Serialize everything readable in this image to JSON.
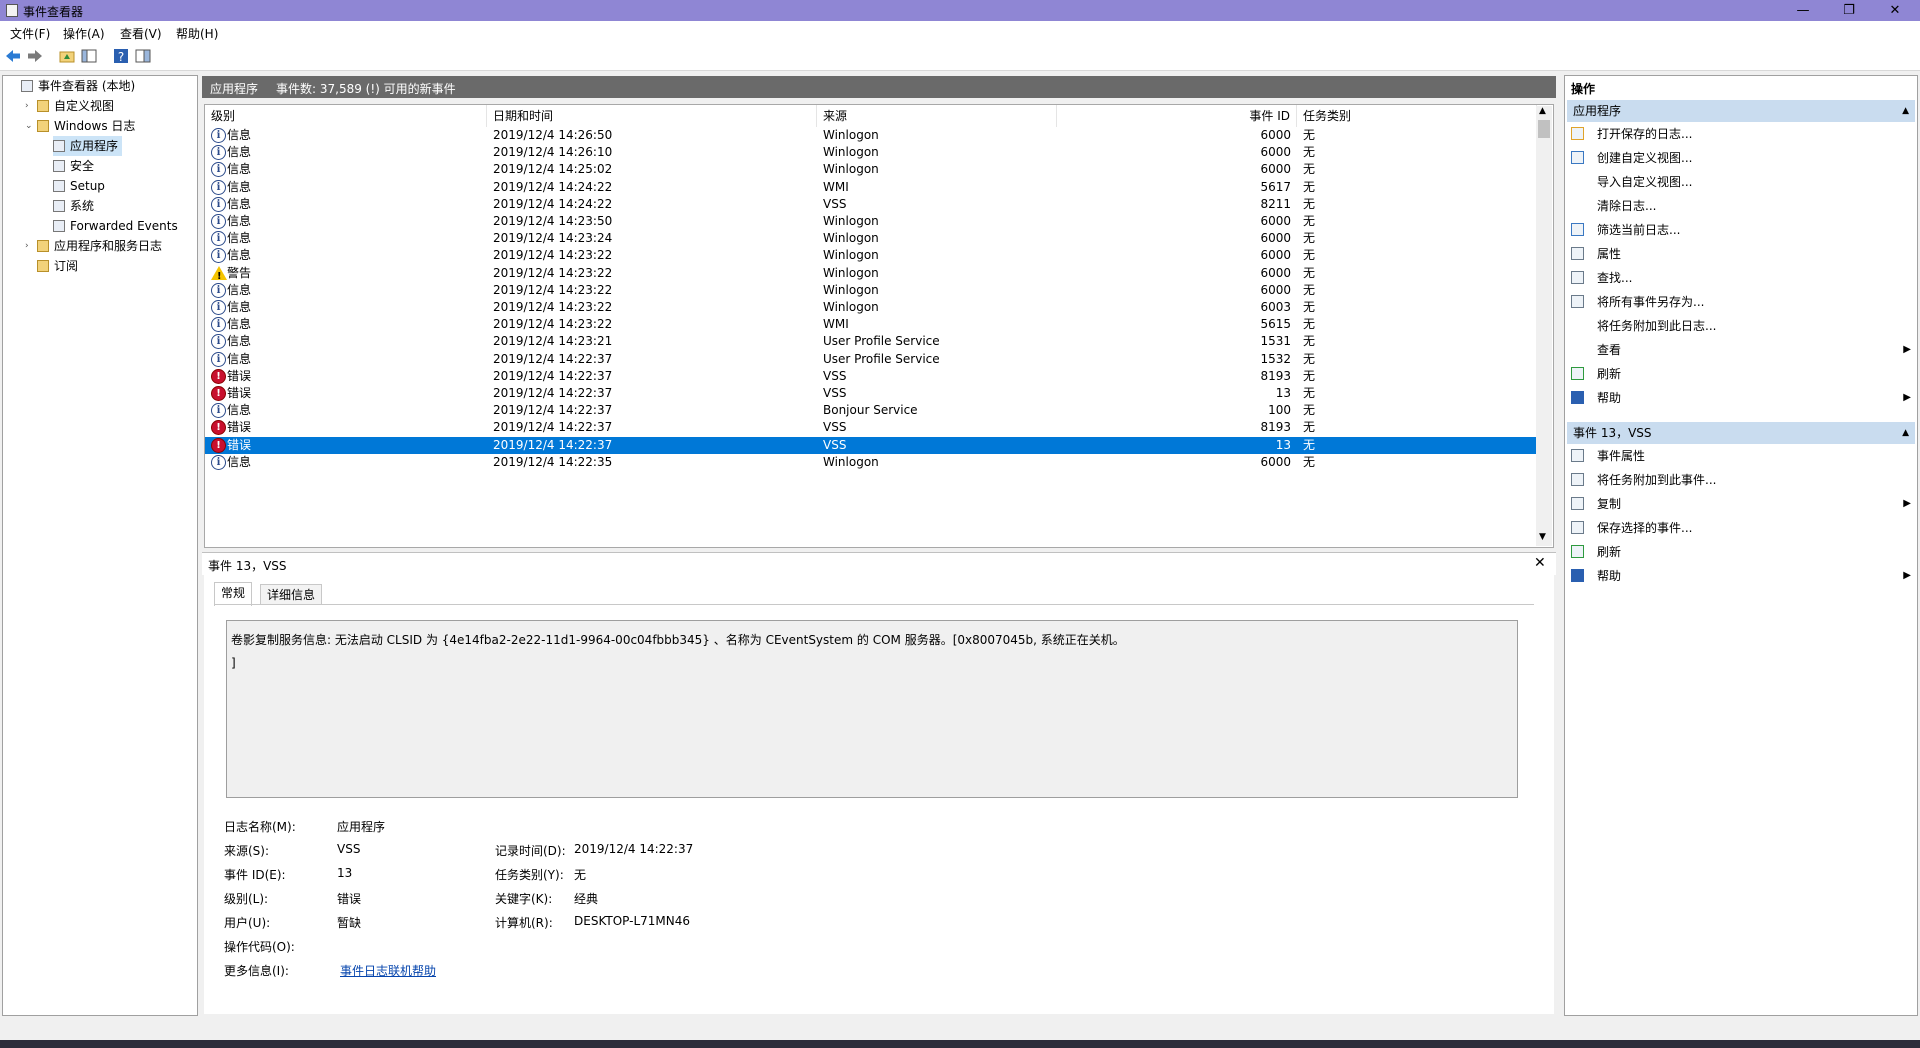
{
  "window": {
    "title": "事件查看器",
    "min": "—",
    "max": "❐",
    "close": "✕"
  },
  "menu": [
    "文件(F)",
    "操作(A)",
    "查看(V)",
    "帮助(H)"
  ],
  "tree": [
    {
      "label": "事件查看器 (本地)",
      "indent": 0,
      "exp": ""
    },
    {
      "label": "自定义视图",
      "indent": 1,
      "exp": "›",
      "folder": true
    },
    {
      "label": "Windows 日志",
      "indent": 1,
      "exp": "⌄",
      "folder": true
    },
    {
      "label": "应用程序",
      "indent": 2,
      "exp": "",
      "selected": true
    },
    {
      "label": "安全",
      "indent": 2,
      "exp": ""
    },
    {
      "label": "Setup",
      "indent": 2,
      "exp": ""
    },
    {
      "label": "系统",
      "indent": 2,
      "exp": ""
    },
    {
      "label": "Forwarded Events",
      "indent": 2,
      "exp": ""
    },
    {
      "label": "应用程序和服务日志",
      "indent": 1,
      "exp": "›",
      "folder": true
    },
    {
      "label": "订阅",
      "indent": 1,
      "exp": "",
      "folder": true
    }
  ],
  "center": {
    "log_name": "应用程序",
    "summary": "事件数: 37,589 (!) 可用的新事件"
  },
  "columns": [
    "级别",
    "日期和时间",
    "来源",
    "事件 ID",
    "任务类别"
  ],
  "events": [
    {
      "level": "info",
      "level_text": "信息",
      "datetime": "2019/12/4 14:26:50",
      "source": "Winlogon",
      "id": "6000",
      "task": "无"
    },
    {
      "level": "info",
      "level_text": "信息",
      "datetime": "2019/12/4 14:26:10",
      "source": "Winlogon",
      "id": "6000",
      "task": "无"
    },
    {
      "level": "info",
      "level_text": "信息",
      "datetime": "2019/12/4 14:25:02",
      "source": "Winlogon",
      "id": "6000",
      "task": "无"
    },
    {
      "level": "info",
      "level_text": "信息",
      "datetime": "2019/12/4 14:24:22",
      "source": "WMI",
      "id": "5617",
      "task": "无"
    },
    {
      "level": "info",
      "level_text": "信息",
      "datetime": "2019/12/4 14:24:22",
      "source": "VSS",
      "id": "8211",
      "task": "无"
    },
    {
      "level": "info",
      "level_text": "信息",
      "datetime": "2019/12/4 14:23:50",
      "source": "Winlogon",
      "id": "6000",
      "task": "无"
    },
    {
      "level": "info",
      "level_text": "信息",
      "datetime": "2019/12/4 14:23:24",
      "source": "Winlogon",
      "id": "6000",
      "task": "无"
    },
    {
      "level": "info",
      "level_text": "信息",
      "datetime": "2019/12/4 14:23:22",
      "source": "Winlogon",
      "id": "6000",
      "task": "无"
    },
    {
      "level": "warn",
      "level_text": "警告",
      "datetime": "2019/12/4 14:23:22",
      "source": "Winlogon",
      "id": "6000",
      "task": "无"
    },
    {
      "level": "info",
      "level_text": "信息",
      "datetime": "2019/12/4 14:23:22",
      "source": "Winlogon",
      "id": "6000",
      "task": "无"
    },
    {
      "level": "info",
      "level_text": "信息",
      "datetime": "2019/12/4 14:23:22",
      "source": "Winlogon",
      "id": "6003",
      "task": "无"
    },
    {
      "level": "info",
      "level_text": "信息",
      "datetime": "2019/12/4 14:23:22",
      "source": "WMI",
      "id": "5615",
      "task": "无"
    },
    {
      "level": "info",
      "level_text": "信息",
      "datetime": "2019/12/4 14:23:21",
      "source": "User Profile Service",
      "id": "1531",
      "task": "无"
    },
    {
      "level": "info",
      "level_text": "信息",
      "datetime": "2019/12/4 14:22:37",
      "source": "User Profile Service",
      "id": "1532",
      "task": "无"
    },
    {
      "level": "err",
      "level_text": "错误",
      "datetime": "2019/12/4 14:22:37",
      "source": "VSS",
      "id": "8193",
      "task": "无"
    },
    {
      "level": "err",
      "level_text": "错误",
      "datetime": "2019/12/4 14:22:37",
      "source": "VSS",
      "id": "13",
      "task": "无"
    },
    {
      "level": "info",
      "level_text": "信息",
      "datetime": "2019/12/4 14:22:37",
      "source": "Bonjour Service",
      "id": "100",
      "task": "无"
    },
    {
      "level": "err",
      "level_text": "错误",
      "datetime": "2019/12/4 14:22:37",
      "source": "VSS",
      "id": "8193",
      "task": "无"
    },
    {
      "level": "err",
      "level_text": "错误",
      "datetime": "2019/12/4 14:22:37",
      "source": "VSS",
      "id": "13",
      "task": "无",
      "selected": true
    },
    {
      "level": "info",
      "level_text": "信息",
      "datetime": "2019/12/4 14:22:35",
      "source": "Winlogon",
      "id": "6000",
      "task": "无"
    }
  ],
  "detail": {
    "title": "事件 13，VSS",
    "tabs": [
      "常规",
      "详细信息"
    ],
    "description_line1": "卷影复制服务信息: 无法启动 CLSID 为 {4e14fba2-2e22-11d1-9964-00c04fbbb345} 、名称为 CEventSystem 的 COM 服务器。[0x8007045b, 系统正在关机。",
    "description_line2": "]",
    "fields": {
      "log_name_label": "日志名称(M):",
      "log_name": "应用程序",
      "source_label": "来源(S):",
      "source": "VSS",
      "logged_label": "记录时间(D):",
      "logged": "2019/12/4 14:22:37",
      "event_id_label": "事件 ID(E):",
      "event_id": "13",
      "task_label": "任务类别(Y):",
      "task": "无",
      "level_label": "级别(L):",
      "level": "错误",
      "keywords_label": "关键字(K):",
      "keywords": "经典",
      "user_label": "用户(U):",
      "user": "暂缺",
      "computer_label": "计算机(R):",
      "computer": "DESKTOP-L71MN46",
      "opcode_label": "操作代码(O):",
      "more_info_label": "更多信息(I):",
      "more_info_link": "事件日志联机帮助"
    }
  },
  "actions": {
    "title": "操作",
    "section1": "应用程序",
    "items1": [
      {
        "label": "打开保存的日志...",
        "icon": "open-log-icon"
      },
      {
        "label": "创建自定义视图...",
        "icon": "create-view-icon"
      },
      {
        "label": "导入自定义视图...",
        "icon": ""
      },
      {
        "label": "清除日志...",
        "icon": ""
      },
      {
        "label": "筛选当前日志...",
        "icon": "filter-icon"
      },
      {
        "label": "属性",
        "icon": "properties-icon"
      },
      {
        "label": "查找...",
        "icon": "find-icon"
      },
      {
        "label": "将所有事件另存为...",
        "icon": "save-icon"
      },
      {
        "label": "将任务附加到此日志...",
        "icon": ""
      },
      {
        "label": "查看",
        "icon": "",
        "arrow": true
      },
      {
        "label": "刷新",
        "icon": "refresh-icon"
      },
      {
        "label": "帮助",
        "icon": "help-icon",
        "arrow": true
      }
    ],
    "section2": "事件 13，VSS",
    "items2": [
      {
        "label": "事件属性",
        "icon": "event-properties-icon"
      },
      {
        "label": "将任务附加到此事件...",
        "icon": "attach-task-icon"
      },
      {
        "label": "复制",
        "icon": "copy-icon",
        "arrow": true
      },
      {
        "label": "保存选择的事件...",
        "icon": "save-icon"
      },
      {
        "label": "刷新",
        "icon": "refresh-icon"
      },
      {
        "label": "帮助",
        "icon": "help-icon",
        "arrow": true
      }
    ]
  },
  "colors": {
    "titlebar": "#8f86d4",
    "selection": "#0078d7",
    "section_header": "#c9dcef"
  }
}
